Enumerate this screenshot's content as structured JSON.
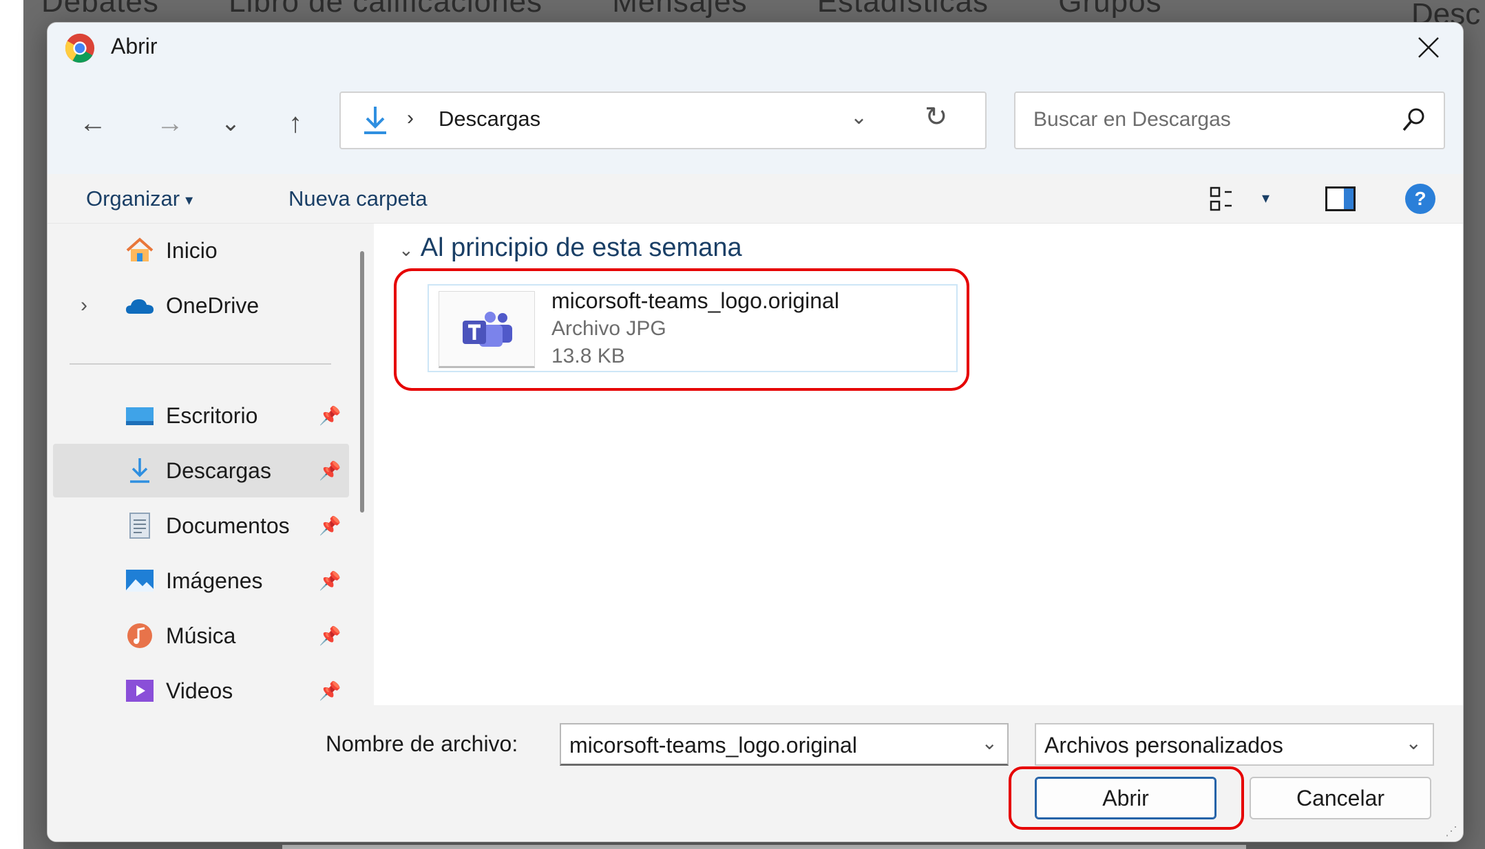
{
  "background": {
    "tabs": [
      "Debates",
      "Libro de calificaciones",
      "Mensajes",
      "Estadísticas",
      "Grupos"
    ],
    "right_text": "Desc"
  },
  "dialog": {
    "title": "Abrir",
    "close_icon": "close-icon"
  },
  "nav": {
    "back": "←",
    "forward": "→",
    "recent": "⌄",
    "up": "↑",
    "address_separator": "›",
    "address_location": "Descargas",
    "address_dropdown": "⌄",
    "refresh": "↻",
    "search_placeholder": "Buscar en Descargas"
  },
  "toolbar": {
    "organize_label": "Organizar",
    "organize_caret": "▾",
    "new_folder_label": "Nueva carpeta",
    "view_caret": "▾",
    "help_label": "?"
  },
  "sidebar": {
    "expand_glyph": "›",
    "pin_glyph": "📌",
    "items": [
      {
        "label": "Inicio",
        "icon": "home-icon"
      },
      {
        "label": "OneDrive",
        "icon": "cloud-icon"
      },
      {
        "label": "Escritorio",
        "icon": "desktop-icon"
      },
      {
        "label": "Descargas",
        "icon": "download-icon"
      },
      {
        "label": "Documentos",
        "icon": "documents-icon"
      },
      {
        "label": "Imágenes",
        "icon": "pictures-icon"
      },
      {
        "label": "Música",
        "icon": "music-icon"
      },
      {
        "label": "Videos",
        "icon": "videos-icon"
      }
    ]
  },
  "content": {
    "group_caret": "⌄",
    "group_label": "Al principio de esta semana",
    "files": [
      {
        "name": "micorsoft-teams_logo.original",
        "type": "Archivo JPG",
        "size": "13.8 KB"
      }
    ]
  },
  "footer": {
    "filename_label": "Nombre de archivo:",
    "filename_value": "micorsoft-teams_logo.original",
    "dropdown_glyph": "⌄",
    "filetype_value": "Archivos personalizados",
    "open_label": "Abrir",
    "cancel_label": "Cancelar",
    "grip": "⋰"
  },
  "colors": {
    "highlight_red": "#e60000",
    "accent_blue": "#2a7fd9",
    "link_navy": "#1a3f66"
  }
}
